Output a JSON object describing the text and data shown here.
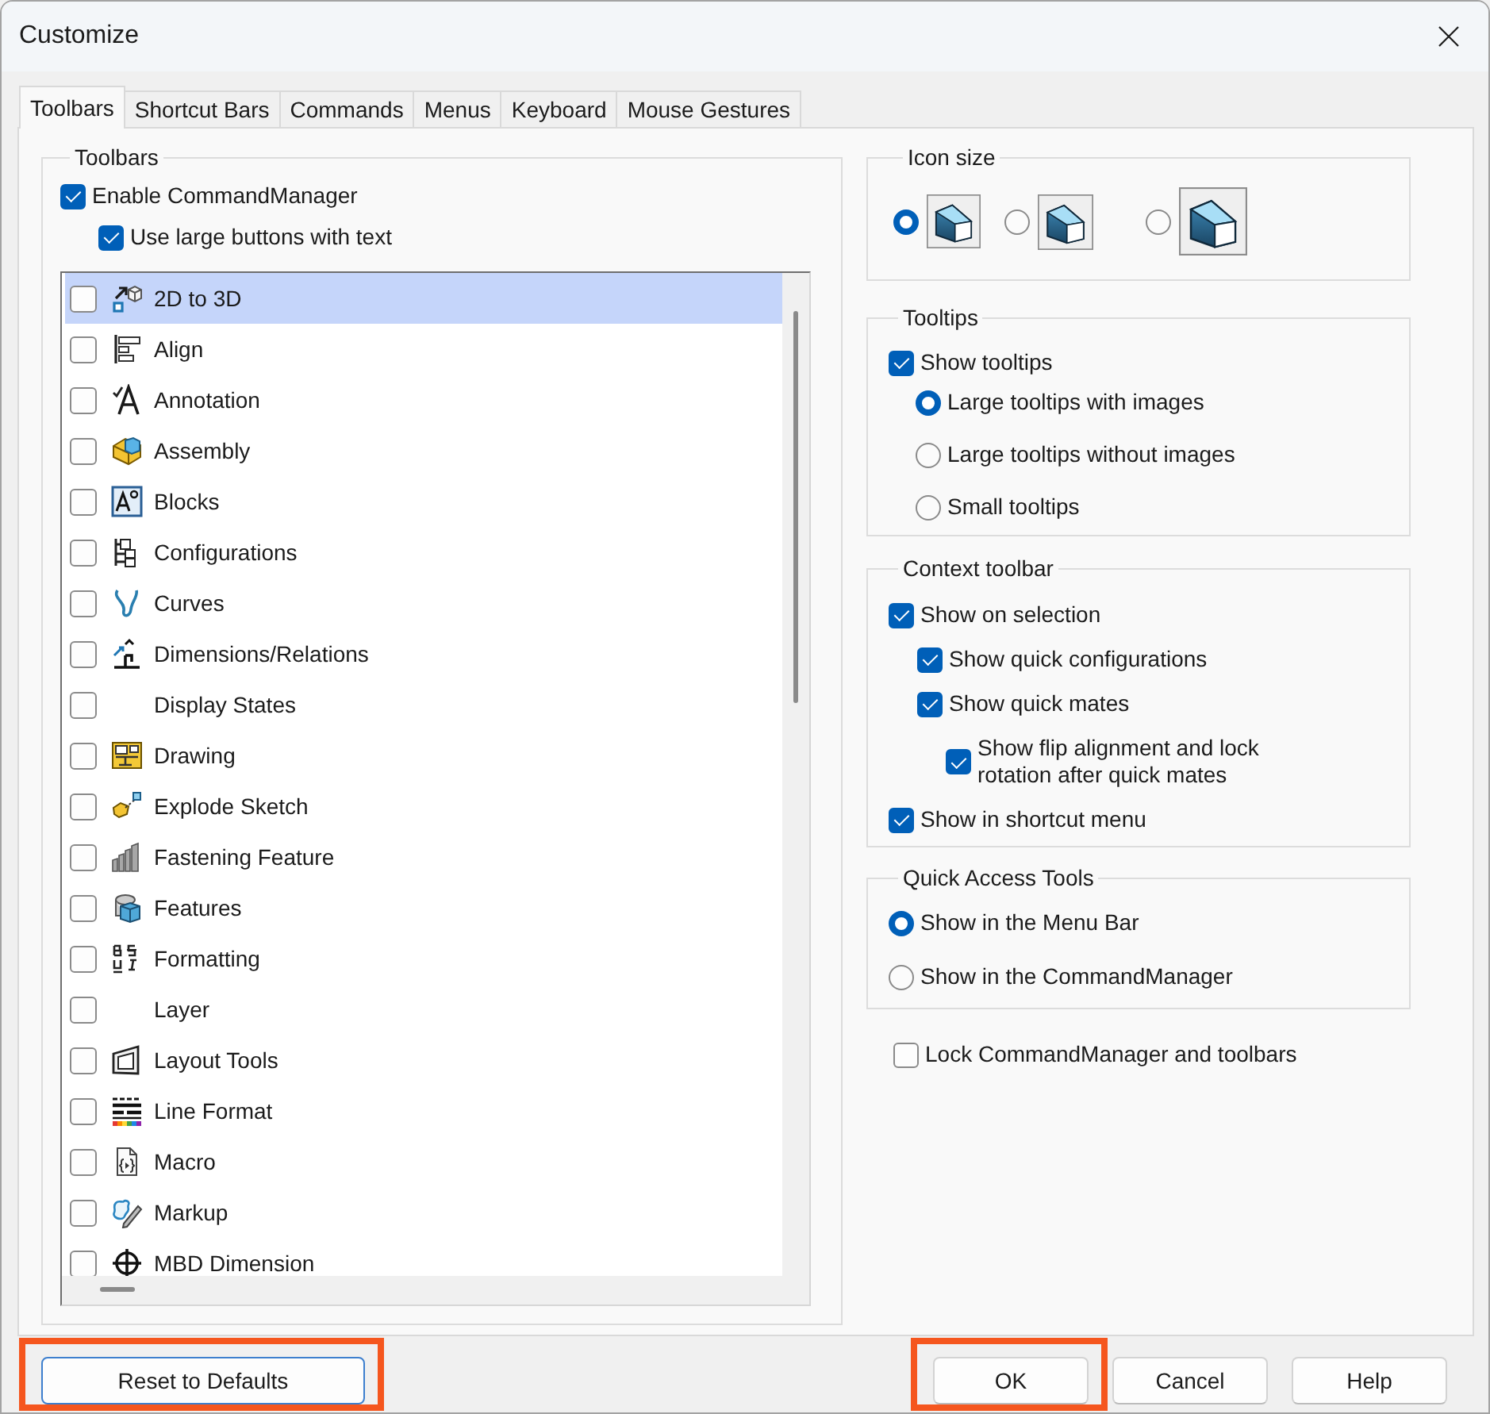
{
  "window": {
    "title": "Customize"
  },
  "tabs": [
    {
      "label": "Toolbars",
      "selected": true
    },
    {
      "label": "Shortcut Bars",
      "selected": false
    },
    {
      "label": "Commands",
      "selected": false
    },
    {
      "label": "Menus",
      "selected": false
    },
    {
      "label": "Keyboard",
      "selected": false
    },
    {
      "label": "Mouse Gestures",
      "selected": false
    }
  ],
  "toolbars_group": {
    "title": "Toolbars",
    "options": [
      {
        "label": "Enable CommandManager",
        "checked": true,
        "children": [
          {
            "label": "Use large buttons with text",
            "checked": true
          }
        ]
      }
    ],
    "list": [
      {
        "label": "2D to 3D",
        "checked": false,
        "selected": true
      },
      {
        "label": "Align",
        "checked": false,
        "selected": false
      },
      {
        "label": "Annotation",
        "checked": false,
        "selected": false
      },
      {
        "label": "Assembly",
        "checked": false,
        "selected": false
      },
      {
        "label": "Blocks",
        "checked": false,
        "selected": false
      },
      {
        "label": "Configurations",
        "checked": false,
        "selected": false
      },
      {
        "label": "Curves",
        "checked": false,
        "selected": false
      },
      {
        "label": "Dimensions/Relations",
        "checked": false,
        "selected": false
      },
      {
        "label": "Display States",
        "checked": false,
        "selected": false
      },
      {
        "label": "Drawing",
        "checked": false,
        "selected": false
      },
      {
        "label": "Explode Sketch",
        "checked": false,
        "selected": false
      },
      {
        "label": "Fastening Feature",
        "checked": false,
        "selected": false
      },
      {
        "label": "Features",
        "checked": false,
        "selected": false
      },
      {
        "label": "Formatting",
        "checked": false,
        "selected": false
      },
      {
        "label": "Layer",
        "checked": false,
        "selected": false
      },
      {
        "label": "Layout Tools",
        "checked": false,
        "selected": false
      },
      {
        "label": "Line Format",
        "checked": false,
        "selected": false
      },
      {
        "label": "Macro",
        "checked": false,
        "selected": false
      },
      {
        "label": "Markup",
        "checked": false,
        "selected": false
      },
      {
        "label": "MBD Dimension",
        "checked": false,
        "selected": false
      }
    ]
  },
  "icon_size": {
    "title": "Icon size",
    "options": [
      {
        "selected": true
      },
      {
        "selected": false
      },
      {
        "selected": false
      }
    ]
  },
  "tooltips": {
    "title": "Tooltips",
    "show": {
      "label": "Show tooltips",
      "checked": true
    },
    "styles": [
      {
        "label": "Large tooltips with images",
        "selected": true
      },
      {
        "label": "Large tooltips without images",
        "selected": false
      },
      {
        "label": "Small tooltips",
        "selected": false
      }
    ]
  },
  "context_toolbar": {
    "title": "Context toolbar",
    "options": [
      {
        "label": "Show on selection",
        "checked": true,
        "children": [
          {
            "label": "Show quick configurations",
            "checked": true
          },
          {
            "label": "Show quick mates",
            "checked": true,
            "children": [
              {
                "label": "Show flip alignment and lock rotation after quick mates",
                "checked": true
              }
            ]
          }
        ]
      },
      {
        "label": "Show in shortcut menu",
        "checked": true
      }
    ]
  },
  "quick_access": {
    "title": "Quick Access Tools",
    "options": [
      {
        "label": "Show in the Menu Bar",
        "selected": true
      },
      {
        "label": "Show in the CommandManager",
        "selected": false
      }
    ]
  },
  "lock": {
    "label": "Lock CommandManager and toolbars",
    "checked": false
  },
  "footer": {
    "left": [
      {
        "label": "Reset to Defaults",
        "focused": true,
        "highlighted": true
      }
    ],
    "right": [
      {
        "label": "OK",
        "focused": false,
        "highlighted": true
      },
      {
        "label": "Cancel",
        "focused": false,
        "highlighted": false
      },
      {
        "label": "Help",
        "focused": false,
        "highlighted": false
      }
    ]
  }
}
